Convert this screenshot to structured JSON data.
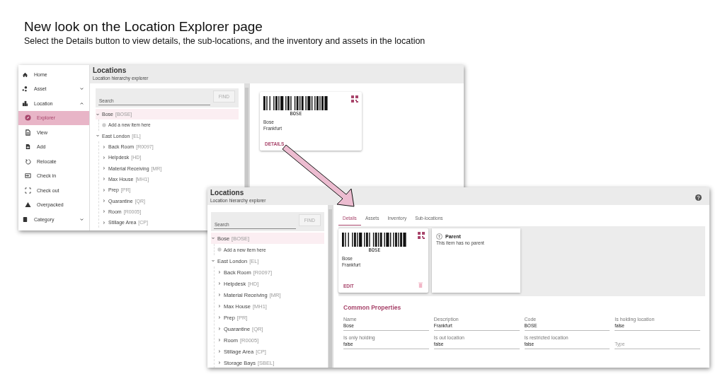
{
  "page_title": "New look on the Location Explorer page",
  "page_subtitle": "Select the Details button to view details, the sub-locations, and the inventory and assets in the location",
  "explorer_window": {
    "sidebar": {
      "items": [
        {
          "label": "Home",
          "kind": "link",
          "selected": false
        },
        {
          "label": "Asset",
          "kind": "group",
          "expanded": false,
          "selected": false
        },
        {
          "label": "Location",
          "kind": "group",
          "expanded": true,
          "selected": false,
          "children": [
            {
              "label": "Explorer",
              "kind": "link",
              "selected": true
            },
            {
              "label": "View",
              "kind": "link",
              "selected": false
            },
            {
              "label": "Add",
              "kind": "link",
              "selected": false
            },
            {
              "label": "Relocate",
              "kind": "link",
              "selected": false
            },
            {
              "label": "Check in",
              "kind": "link",
              "selected": false
            },
            {
              "label": "Check out",
              "kind": "link",
              "selected": false
            },
            {
              "label": "Overpacked",
              "kind": "link",
              "selected": false
            }
          ]
        },
        {
          "label": "Category",
          "kind": "group",
          "expanded": false,
          "selected": false
        }
      ]
    },
    "header": {
      "title": "Locations",
      "subtitle": "Location hierarchy explorer"
    },
    "search": {
      "placeholder": "Search",
      "button": "FIND"
    },
    "tree": [
      {
        "kind": "node",
        "name": "Bose",
        "code": "[BOSE]",
        "expanded": true,
        "selected": true,
        "children": [
          {
            "kind": "add",
            "name": "Add a new item here"
          }
        ]
      },
      {
        "kind": "node",
        "name": "East London",
        "code": "[EL]",
        "expanded": true,
        "selected": false,
        "children": [
          {
            "kind": "node",
            "name": "Back Room",
            "code": "[R0097]",
            "expanded": false,
            "selected": false
          },
          {
            "kind": "node",
            "name": "Helpdesk",
            "code": "[HD]",
            "expanded": false,
            "selected": false
          },
          {
            "kind": "node",
            "name": "Material Receiving",
            "code": "[MR]",
            "expanded": false,
            "selected": false
          },
          {
            "kind": "node",
            "name": "Max House",
            "code": "[MH1]",
            "expanded": false,
            "selected": false
          },
          {
            "kind": "node",
            "name": "Prep",
            "code": "[PR]",
            "expanded": false,
            "selected": false
          },
          {
            "kind": "node",
            "name": "Quarantine",
            "code": "[QR]",
            "expanded": false,
            "selected": false
          },
          {
            "kind": "node",
            "name": "Room",
            "code": "[R0005]",
            "expanded": false,
            "selected": false
          },
          {
            "kind": "node",
            "name": "Stillage Area",
            "code": "[CP]",
            "expanded": false,
            "selected": false
          }
        ]
      }
    ],
    "card": {
      "barcode": "BOSE",
      "name": "Bose",
      "description": "Frankfurt",
      "action": "DETAILS"
    }
  },
  "details_window": {
    "header": {
      "title": "Locations",
      "subtitle": "Location hierarchy explorer"
    },
    "search": {
      "placeholder": "Search",
      "button": "FIND"
    },
    "tree": [
      {
        "kind": "node",
        "name": "Bose",
        "code": "[BOSE]",
        "expanded": true,
        "selected": true,
        "children": [
          {
            "kind": "add",
            "name": "Add a new item here"
          }
        ]
      },
      {
        "kind": "node",
        "name": "East London",
        "code": "[EL]",
        "expanded": true,
        "selected": false,
        "children": [
          {
            "kind": "node",
            "name": "Back Room",
            "code": "[R0097]",
            "expanded": false,
            "selected": false
          },
          {
            "kind": "node",
            "name": "Helpdesk",
            "code": "[HD]",
            "expanded": false,
            "selected": false
          },
          {
            "kind": "node",
            "name": "Material Receiving",
            "code": "[MR]",
            "expanded": false,
            "selected": false
          },
          {
            "kind": "node",
            "name": "Max House",
            "code": "[MH1]",
            "expanded": false,
            "selected": false
          },
          {
            "kind": "node",
            "name": "Prep",
            "code": "[PR]",
            "expanded": false,
            "selected": false
          },
          {
            "kind": "node",
            "name": "Quarantine",
            "code": "[QR]",
            "expanded": false,
            "selected": false
          },
          {
            "kind": "node",
            "name": "Room",
            "code": "[R0005]",
            "expanded": false,
            "selected": false
          },
          {
            "kind": "node",
            "name": "Stillage Area",
            "code": "[CP]",
            "expanded": false,
            "selected": false
          },
          {
            "kind": "node",
            "name": "Storage Bays",
            "code": "[SBEL]",
            "expanded": false,
            "selected": false
          }
        ]
      }
    ],
    "tabs": [
      {
        "label": "Details",
        "selected": true
      },
      {
        "label": "Assets",
        "selected": false
      },
      {
        "label": "Inventory",
        "selected": false
      },
      {
        "label": "Sub-locations",
        "selected": false
      }
    ],
    "card": {
      "barcode": "BOSE",
      "name": "Bose",
      "description": "Frankfurt",
      "action": "EDIT"
    },
    "parent": {
      "title": "Parent",
      "text": "This item has no parent"
    },
    "section_title": "Common Properties",
    "fields": [
      {
        "label": "Name",
        "value": "Bose"
      },
      {
        "label": "Description",
        "value": "Frankfurt"
      },
      {
        "label": "Code",
        "value": "BOSE"
      },
      {
        "label": "Is holding location",
        "value": "false"
      },
      {
        "label": "Is only holding",
        "value": "false"
      },
      {
        "label": "Is out location",
        "value": "false"
      },
      {
        "label": "Is restricted location",
        "value": "false"
      },
      {
        "placeholder": "Type"
      }
    ]
  }
}
